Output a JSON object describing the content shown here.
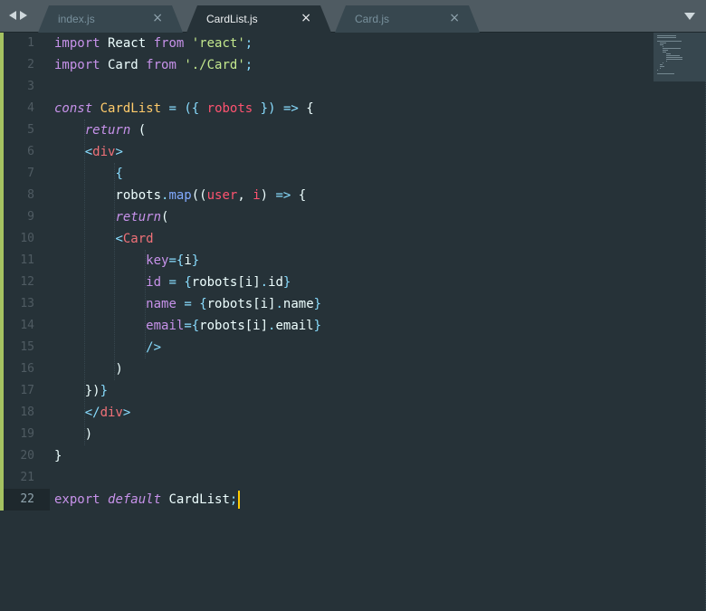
{
  "tabs": [
    {
      "label": "index.js",
      "close": "×"
    },
    {
      "label": "CardList.js",
      "close": "×"
    },
    {
      "label": "Card.js",
      "close": "×"
    }
  ],
  "active_tab": 1,
  "icons": {
    "nav_back": "triangle-left-icon",
    "nav_forward": "triangle-right-icon",
    "tab_menu": "chevron-down-icon"
  },
  "colors": {
    "background": "#263238",
    "tab_bar": "#4f5b62",
    "keyword": "#c792ea",
    "string": "#c3e88d",
    "type": "#ffcb6b",
    "param": "#ff5370",
    "tag": "#f07178",
    "cursor": "#ffcc00"
  },
  "editor": {
    "current_line": 22,
    "line_numbers": [
      "1",
      "2",
      "3",
      "4",
      "5",
      "6",
      "7",
      "8",
      "9",
      "10",
      "11",
      "12",
      "13",
      "14",
      "15",
      "16",
      "17",
      "18",
      "19",
      "20",
      "21",
      "22"
    ],
    "lines": [
      [
        [
          "kw",
          "import"
        ],
        [
          "plain",
          " React "
        ],
        [
          "kw",
          "from"
        ],
        [
          "plain",
          " "
        ],
        [
          "str",
          "'react'"
        ],
        [
          "punct",
          ";"
        ]
      ],
      [
        [
          "kw",
          "import"
        ],
        [
          "plain",
          " Card "
        ],
        [
          "kw",
          "from"
        ],
        [
          "plain",
          " "
        ],
        [
          "str",
          "'./Card'"
        ],
        [
          "punct",
          ";"
        ]
      ],
      [],
      [
        [
          "kw-it",
          "const"
        ],
        [
          "plain",
          " "
        ],
        [
          "type",
          "CardList"
        ],
        [
          "plain",
          " "
        ],
        [
          "punct",
          "="
        ],
        [
          "plain",
          " "
        ],
        [
          "punct",
          "({"
        ],
        [
          "plain",
          " "
        ],
        [
          "param",
          "robots"
        ],
        [
          "plain",
          " "
        ],
        [
          "punct",
          "})"
        ],
        [
          "plain",
          " "
        ],
        [
          "punct",
          "=>"
        ],
        [
          "plain",
          " {"
        ]
      ],
      [
        [
          "plain",
          "    "
        ],
        [
          "kw-it",
          "return"
        ],
        [
          "plain",
          " ("
        ]
      ],
      [
        [
          "plain",
          "    "
        ],
        [
          "punct",
          "<"
        ],
        [
          "tag",
          "div"
        ],
        [
          "punct",
          ">"
        ]
      ],
      [
        [
          "plain",
          "        "
        ],
        [
          "punct",
          "{"
        ]
      ],
      [
        [
          "plain",
          "        robots"
        ],
        [
          "punct",
          "."
        ],
        [
          "fn",
          "map"
        ],
        [
          "plain",
          "(("
        ],
        [
          "param",
          "user"
        ],
        [
          "plain",
          ", "
        ],
        [
          "param",
          "i"
        ],
        [
          "plain",
          ") "
        ],
        [
          "punct",
          "=>"
        ],
        [
          "plain",
          " {"
        ]
      ],
      [
        [
          "plain",
          "        "
        ],
        [
          "kw-it",
          "return"
        ],
        [
          "plain",
          "("
        ]
      ],
      [
        [
          "plain",
          "        "
        ],
        [
          "punct",
          "<"
        ],
        [
          "tag",
          "Card"
        ]
      ],
      [
        [
          "plain",
          "            "
        ],
        [
          "attr",
          "key"
        ],
        [
          "punct",
          "={"
        ],
        [
          "plain",
          "i"
        ],
        [
          "punct",
          "}"
        ]
      ],
      [
        [
          "plain",
          "            "
        ],
        [
          "attr",
          "id"
        ],
        [
          "plain",
          " "
        ],
        [
          "punct",
          "="
        ],
        [
          "plain",
          " "
        ],
        [
          "punct",
          "{"
        ],
        [
          "plain",
          "robots[i]"
        ],
        [
          "punct",
          "."
        ],
        [
          "plain",
          "id"
        ],
        [
          "punct",
          "}"
        ]
      ],
      [
        [
          "plain",
          "            "
        ],
        [
          "attr",
          "name"
        ],
        [
          "plain",
          " "
        ],
        [
          "punct",
          "="
        ],
        [
          "plain",
          " "
        ],
        [
          "punct",
          "{"
        ],
        [
          "plain",
          "robots[i]"
        ],
        [
          "punct",
          "."
        ],
        [
          "plain",
          "name"
        ],
        [
          "punct",
          "}"
        ]
      ],
      [
        [
          "plain",
          "            "
        ],
        [
          "attr",
          "email"
        ],
        [
          "punct",
          "={"
        ],
        [
          "plain",
          "robots[i]"
        ],
        [
          "punct",
          "."
        ],
        [
          "plain",
          "email"
        ],
        [
          "punct",
          "}"
        ]
      ],
      [
        [
          "plain",
          "            "
        ],
        [
          "punct",
          "/>"
        ]
      ],
      [
        [
          "plain",
          "        )"
        ]
      ],
      [
        [
          "plain",
          "    })"
        ],
        [
          "punct",
          "}"
        ]
      ],
      [
        [
          "plain",
          "    "
        ],
        [
          "punct",
          "</"
        ],
        [
          "tag",
          "div"
        ],
        [
          "punct",
          ">"
        ]
      ],
      [
        [
          "plain",
          "    )"
        ]
      ],
      [
        [
          "plain",
          "}"
        ]
      ],
      [],
      [
        [
          "kw",
          "export"
        ],
        [
          "plain",
          " "
        ],
        [
          "kw-it",
          "default"
        ],
        [
          "plain",
          " CardList"
        ],
        [
          "punct",
          ";"
        ]
      ]
    ]
  }
}
